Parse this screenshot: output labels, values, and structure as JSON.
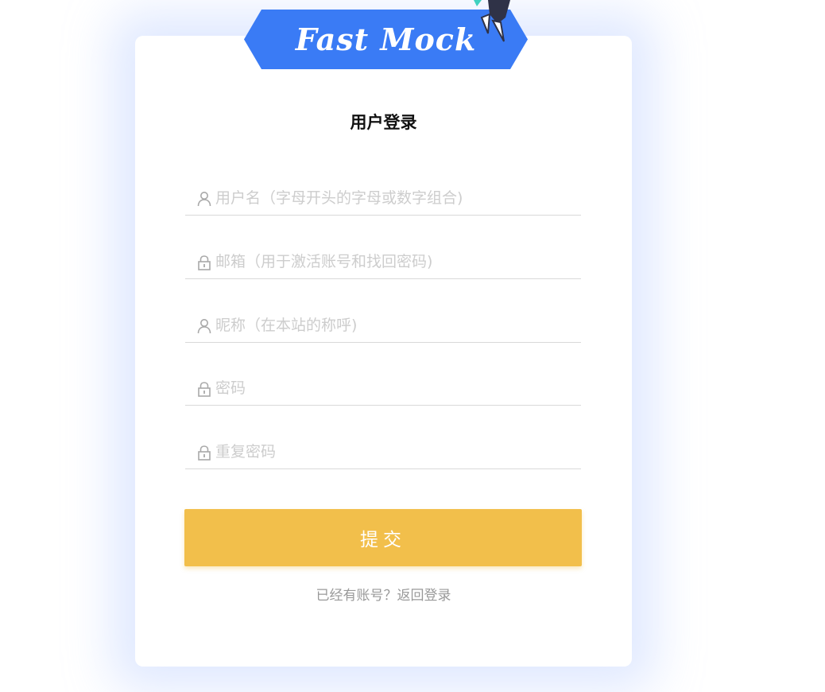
{
  "brand": {
    "logo_text": "Fast Mock",
    "banner_color": "#3a7bf5"
  },
  "form": {
    "title": "用户登录",
    "fields": [
      {
        "placeholder": "用户名（字母开头的字母或数字组合)",
        "icon": "user-icon",
        "value": ""
      },
      {
        "placeholder": "邮箱（用于激活账号和找回密码)",
        "icon": "lock-icon",
        "value": ""
      },
      {
        "placeholder": "昵称（在本站的称呼)",
        "icon": "user-icon",
        "value": ""
      },
      {
        "placeholder": "密码",
        "icon": "lock-icon",
        "value": ""
      },
      {
        "placeholder": "重复密码",
        "icon": "lock-icon",
        "value": ""
      }
    ],
    "submit_label": "提交",
    "submit_color": "#f2bf4b",
    "footer_link": "已经有账号？返回登录"
  }
}
